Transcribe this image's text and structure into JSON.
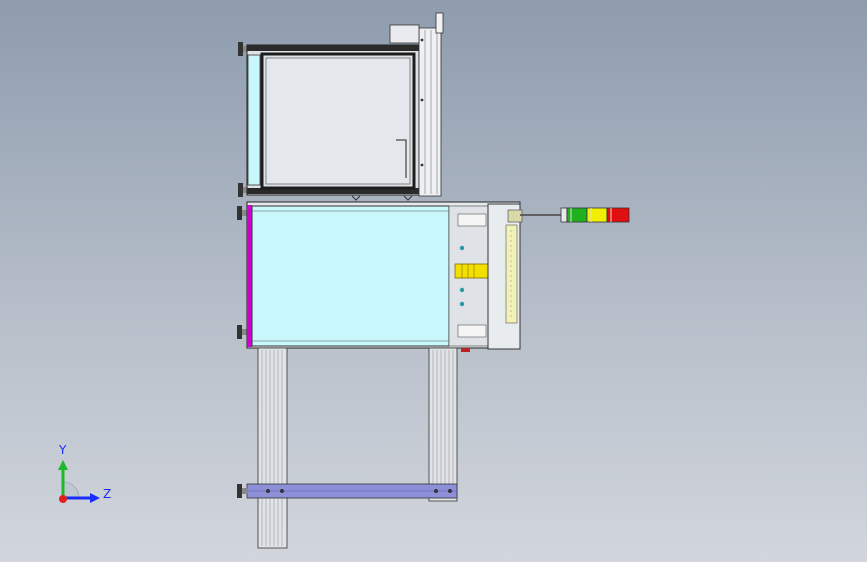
{
  "viewport": {
    "background_top": "#8e9cae",
    "background_bottom": "#d2d6dc"
  },
  "triad": {
    "y_label": "Y",
    "z_label": "Z",
    "y_color": "#1eb82a",
    "z_color": "#1a2bff",
    "x_color": "#e0201a"
  },
  "stack_light": {
    "colors": [
      "#e01010",
      "#f0f000",
      "#20b020"
    ]
  },
  "model": {
    "glass_color": "#c8f8fb",
    "frame_color": "#1c1c1c",
    "accent_edge_color": "#d000d0",
    "rail_color": "#8d8fd8"
  }
}
